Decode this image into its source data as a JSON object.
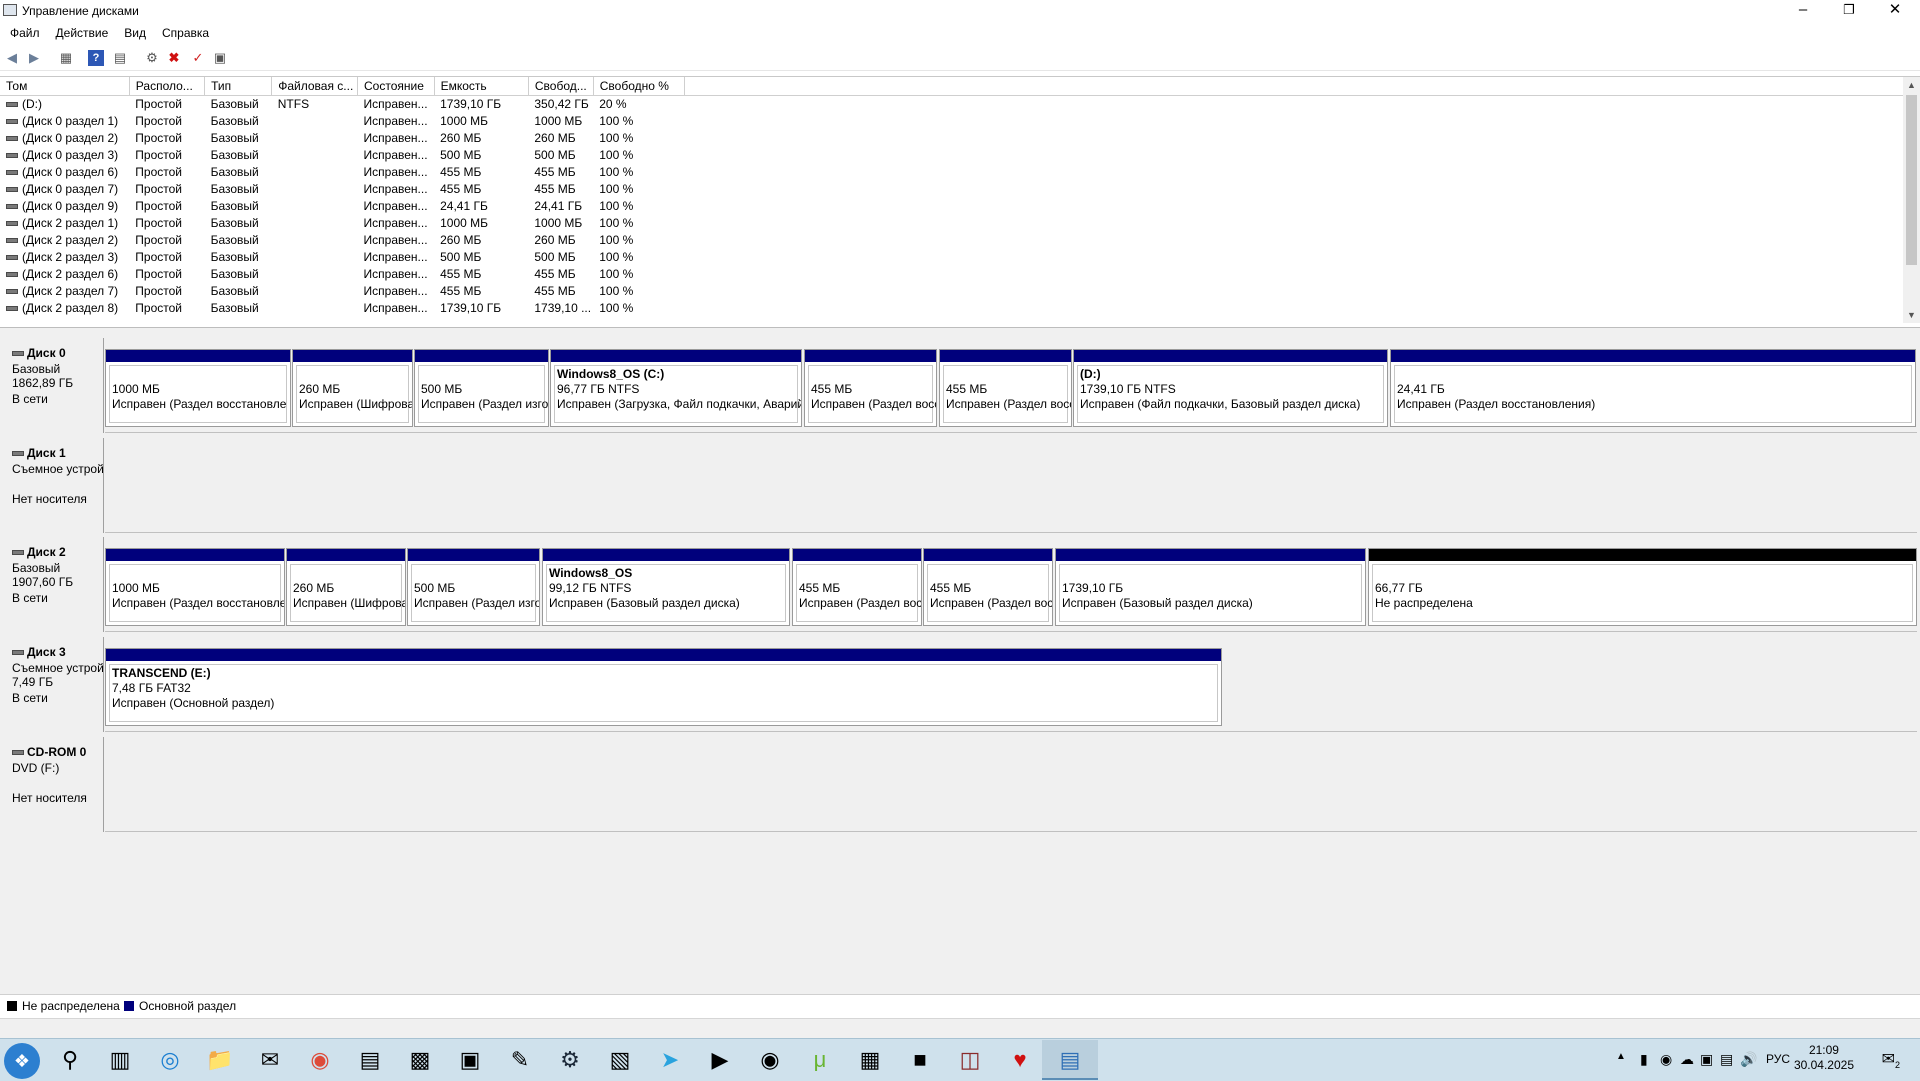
{
  "window": {
    "title": "Управление дисками"
  },
  "menu": [
    "Файл",
    "Действие",
    "Вид",
    "Справка"
  ],
  "columns": [
    "Том",
    "Располо...",
    "Тип",
    "Файловая с...",
    "Состояние",
    "Емкость",
    "Свобод...",
    "Свободно %"
  ],
  "volumes": [
    [
      "(D:)",
      "Простой",
      "Базовый",
      "NTFS",
      "Исправен...",
      "1739,10 ГБ",
      "350,42 ГБ",
      "20 %"
    ],
    [
      "(Диск 0 раздел 1)",
      "Простой",
      "Базовый",
      "",
      "Исправен...",
      "1000 МБ",
      "1000 МБ",
      "100 %"
    ],
    [
      "(Диск 0 раздел 2)",
      "Простой",
      "Базовый",
      "",
      "Исправен...",
      "260 МБ",
      "260 МБ",
      "100 %"
    ],
    [
      "(Диск 0 раздел 3)",
      "Простой",
      "Базовый",
      "",
      "Исправен...",
      "500 МБ",
      "500 МБ",
      "100 %"
    ],
    [
      "(Диск 0 раздел 6)",
      "Простой",
      "Базовый",
      "",
      "Исправен...",
      "455 МБ",
      "455 МБ",
      "100 %"
    ],
    [
      "(Диск 0 раздел 7)",
      "Простой",
      "Базовый",
      "",
      "Исправен...",
      "455 МБ",
      "455 МБ",
      "100 %"
    ],
    [
      "(Диск 0 раздел 9)",
      "Простой",
      "Базовый",
      "",
      "Исправен...",
      "24,41 ГБ",
      "24,41 ГБ",
      "100 %"
    ],
    [
      "(Диск 2 раздел 1)",
      "Простой",
      "Базовый",
      "",
      "Исправен...",
      "1000 МБ",
      "1000 МБ",
      "100 %"
    ],
    [
      "(Диск 2 раздел 2)",
      "Простой",
      "Базовый",
      "",
      "Исправен...",
      "260 МБ",
      "260 МБ",
      "100 %"
    ],
    [
      "(Диск 2 раздел 3)",
      "Простой",
      "Базовый",
      "",
      "Исправен...",
      "500 МБ",
      "500 МБ",
      "100 %"
    ],
    [
      "(Диск 2 раздел 6)",
      "Простой",
      "Базовый",
      "",
      "Исправен...",
      "455 МБ",
      "455 МБ",
      "100 %"
    ],
    [
      "(Диск 2 раздел 7)",
      "Простой",
      "Базовый",
      "",
      "Исправен...",
      "455 МБ",
      "455 МБ",
      "100 %"
    ],
    [
      "(Диск 2 раздел 8)",
      "Простой",
      "Базовый",
      "",
      "Исправен...",
      "1739,10 ГБ",
      "1739,10 ...",
      "100 %"
    ]
  ],
  "disks": [
    {
      "name": "Диск 0",
      "l2": "Базовый",
      "l3": "1862,89 ГБ",
      "l4": "В сети",
      "parts": [
        {
          "title": "",
          "size": "1000 МБ",
          "status": "Исправен (Раздел восстановле",
          "type": "primary"
        },
        {
          "title": "",
          "size": "260 МБ",
          "status": "Исправен (Шифрованнь",
          "type": "primary"
        },
        {
          "title": "",
          "size": "500 МБ",
          "status": "Исправен (Раздел изготови",
          "type": "primary"
        },
        {
          "title": "Windows8_OS  (C:)",
          "size": "96,77 ГБ NTFS",
          "status": "Исправен (Загрузка, Файл подкачки, Аварийный дам",
          "type": "primary"
        },
        {
          "title": "",
          "size": "455 МБ",
          "status": "Исправен (Раздел восстанс",
          "type": "primary"
        },
        {
          "title": "",
          "size": "455 МБ",
          "status": "Исправен (Раздел восстанс",
          "type": "primary"
        },
        {
          "title": "(D:)",
          "size": "1739,10 ГБ NTFS",
          "status": "Исправен (Файл подкачки, Базовый раздел диска)",
          "type": "primary"
        },
        {
          "title": "",
          "size": "24,41 ГБ",
          "status": "Исправен (Раздел восстановления)",
          "type": "primary"
        }
      ]
    },
    {
      "name": "Диск 1",
      "l2": "Съемное устрой",
      "l3": "",
      "l4": "Нет носителя",
      "parts": []
    },
    {
      "name": "Диск 2",
      "l2": "Базовый",
      "l3": "1907,60 ГБ",
      "l4": "В сети",
      "parts": [
        {
          "title": "",
          "size": "1000 МБ",
          "status": "Исправен (Раздел восстановле",
          "type": "primary"
        },
        {
          "title": "",
          "size": "260 МБ",
          "status": "Исправен (Шифрованнь",
          "type": "primary"
        },
        {
          "title": "",
          "size": "500 МБ",
          "status": "Исправен (Раздел изготови",
          "type": "primary"
        },
        {
          "title": "Windows8_OS",
          "size": "99,12 ГБ NTFS",
          "status": "Исправен (Базовый раздел диска)",
          "type": "primary"
        },
        {
          "title": "",
          "size": "455 МБ",
          "status": "Исправен (Раздел восстан",
          "type": "primary"
        },
        {
          "title": "",
          "size": "455 МБ",
          "status": "Исправен (Раздел восстан",
          "type": "primary"
        },
        {
          "title": "",
          "size": "1739,10 ГБ",
          "status": "Исправен (Базовый раздел диска)",
          "type": "primary"
        },
        {
          "title": "",
          "size": "66,77 ГБ",
          "status": "Не распределена",
          "type": "unallocated"
        }
      ]
    },
    {
      "name": "Диск 3",
      "l2": "Съемное устрой",
      "l3": "7,49 ГБ",
      "l4": "В сети",
      "parts": [
        {
          "title": "TRANSCEND  (E:)",
          "size": "7,48 ГБ FAT32",
          "status": "Исправен (Основной раздел)",
          "type": "primary"
        }
      ]
    },
    {
      "name": "CD-ROM 0",
      "l2": "DVD (F:)",
      "l3": "",
      "l4": "Нет носителя",
      "parts": []
    }
  ],
  "legend": {
    "unallocated": "Не распределена",
    "primary": "Основной раздел",
    "unallocated_color": "#000000",
    "primary_color": "#00007c"
  },
  "taskbar": {
    "apps": [
      "search-icon",
      "task-view-icon",
      "edge-icon",
      "explorer-icon",
      "mail-icon",
      "chrome-icon",
      "monitor-icon",
      "chip-icon",
      "archive-icon",
      "notepad-icon",
      "steam-icon",
      "terminal-icon",
      "telegram-icon",
      "media-icon",
      "speaker-icon",
      "utorrent-icon",
      "window-icon",
      "usb-icon",
      "winrar-icon",
      "hp-icon",
      "disk-mgmt-icon"
    ],
    "lang": "РУС",
    "time": "21:09",
    "date": "30.04.2025",
    "notifications": "2"
  }
}
